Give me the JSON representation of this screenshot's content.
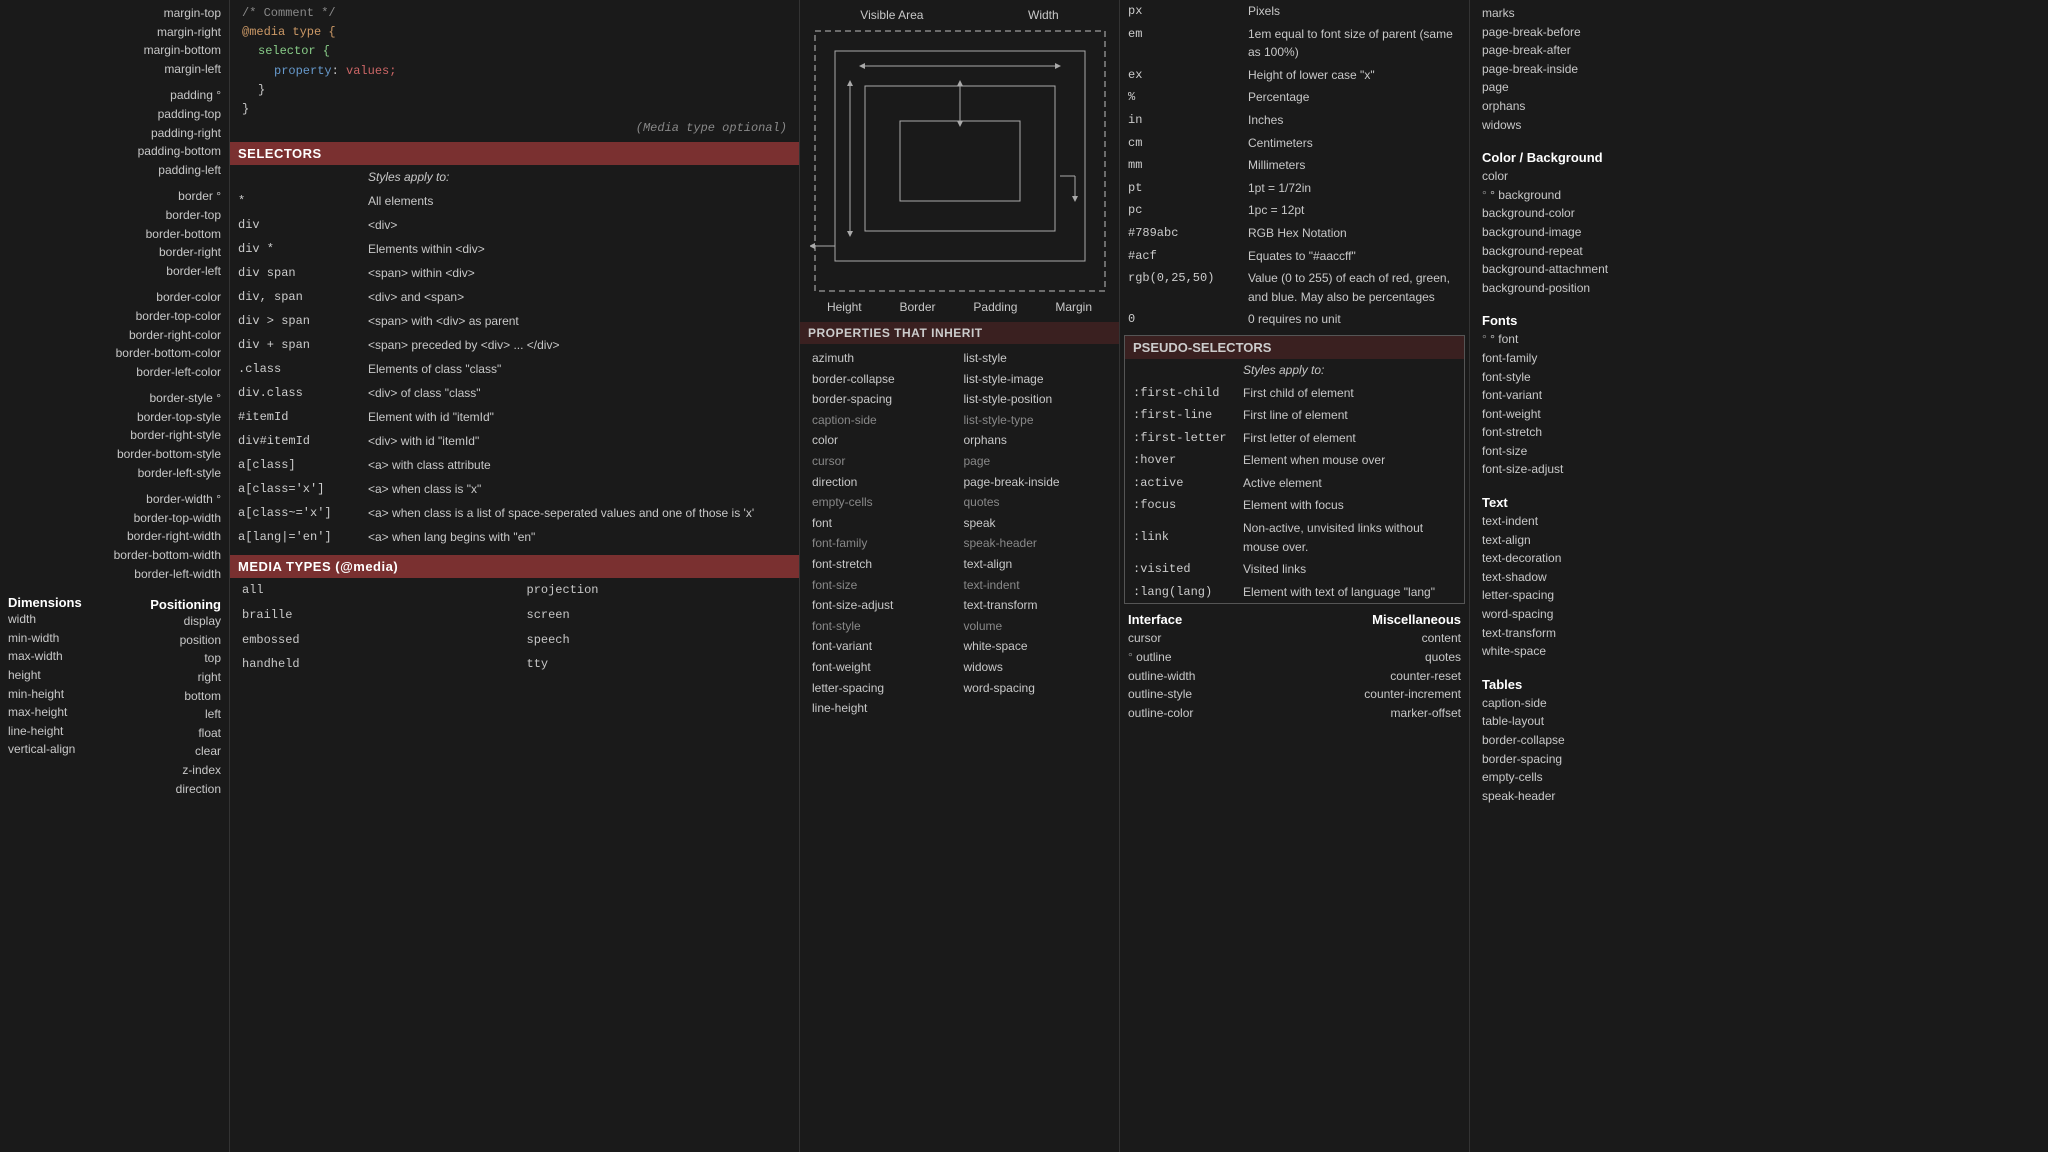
{
  "left": {
    "box_model_items": [
      {
        "label": "margin-top",
        "dot": false
      },
      {
        "label": "margin-right",
        "dot": false
      },
      {
        "label": "margin-bottom",
        "dot": false
      },
      {
        "label": "margin-left",
        "dot": false
      },
      {
        "label": "padding",
        "dot": true
      },
      {
        "label": "padding-top",
        "dot": false
      },
      {
        "label": "padding-right",
        "dot": false
      },
      {
        "label": "padding-bottom",
        "dot": false
      },
      {
        "label": "padding-left",
        "dot": false
      },
      {
        "label": "border",
        "dot": true
      },
      {
        "label": "border-top",
        "dot": false
      },
      {
        "label": "border-bottom",
        "dot": false
      },
      {
        "label": "border-right",
        "dot": false
      },
      {
        "label": "border-left",
        "dot": false
      },
      {
        "label": "border-color",
        "dot": false
      },
      {
        "label": "border-top-color",
        "dot": false
      },
      {
        "label": "border-right-color",
        "dot": false
      },
      {
        "label": "border-bottom-color",
        "dot": false
      },
      {
        "label": "border-left-color",
        "dot": false
      },
      {
        "label": "border-style",
        "dot": true
      },
      {
        "label": "border-top-style",
        "dot": false
      },
      {
        "label": "border-right-style",
        "dot": false
      },
      {
        "label": "border-bottom-style",
        "dot": false
      },
      {
        "label": "border-left-style",
        "dot": false
      },
      {
        "label": "border-width",
        "dot": true
      },
      {
        "label": "border-top-width",
        "dot": false
      },
      {
        "label": "border-right-width",
        "dot": false
      },
      {
        "label": "border-bottom-width",
        "dot": false
      },
      {
        "label": "border-left-width",
        "dot": false
      }
    ],
    "positioning_title": "Positioning",
    "positioning_items": [
      {
        "label": "display",
        "side": "right"
      },
      {
        "label": "position",
        "side": "right"
      },
      {
        "label": "top",
        "side": "right"
      },
      {
        "label": "right",
        "side": "right"
      },
      {
        "label": "bottom",
        "side": "right"
      },
      {
        "label": "left",
        "side": "right"
      },
      {
        "label": "float",
        "side": "right"
      },
      {
        "label": "clear",
        "side": "right"
      },
      {
        "label": "z-index",
        "side": "right"
      },
      {
        "label": "direction",
        "side": "right"
      }
    ],
    "dimensions_title": "Dimensions",
    "dimensions_items": [
      "width",
      "min-width",
      "max-width",
      "height",
      "min-height",
      "max-height",
      "line-height",
      "vertical-align"
    ]
  },
  "middle": {
    "code_lines": [
      {
        "text": "/* Comment */",
        "type": "comment"
      },
      {
        "text": "@media type {",
        "type": "at"
      },
      {
        "text": "    selector {",
        "type": "selector",
        "indent": 1
      },
      {
        "text": "        property: values;",
        "type": "property",
        "indent": 2
      },
      {
        "text": "    }",
        "type": "brace",
        "indent": 1
      },
      {
        "text": "}",
        "type": "brace"
      },
      {
        "text": "(Media type optional)",
        "type": "italic"
      }
    ],
    "selectors_title": "SELECTORS",
    "selectors_style_header": "Styles apply to:",
    "selectors_rows": [
      {
        "selector": "*",
        "description": "All elements"
      },
      {
        "selector": "div",
        "description": "<div>"
      },
      {
        "selector": "div *",
        "description": "Elements within <div>"
      },
      {
        "selector": "div span",
        "description": "<span> within <div>"
      },
      {
        "selector": "div, span",
        "description": "<div> and <span>"
      },
      {
        "selector": "div > span",
        "description": "<span> with <div> as parent"
      },
      {
        "selector": "div + span",
        "description": "<span> preceded by <div> ... </div>"
      },
      {
        "selector": ".class",
        "description": "Elements of class \"class\""
      },
      {
        "selector": "div.class",
        "description": "<div> of class \"class\""
      },
      {
        "selector": "#itemId",
        "description": "Element with id \"itemId\""
      },
      {
        "selector": "div#itemId",
        "description": "<div> with id \"itemId\""
      },
      {
        "selector": "a[class]",
        "description": "<a> with class attribute"
      },
      {
        "selector": "a[class='x']",
        "description": "<a> when class is \"x\""
      },
      {
        "selector": "a[class~='x']",
        "description": "<a> when class is a list of space-seperated values and one of those is 'x'"
      },
      {
        "selector": "a[lang|='en']",
        "description": "<a> when lang begins with \"en\""
      }
    ],
    "media_title": "MEDIA TYPES (@media)",
    "media_rows": [
      {
        "col1": "all",
        "col2": "projection"
      },
      {
        "col1": "braille",
        "col2": "screen"
      },
      {
        "col1": "embossed",
        "col2": "speech"
      },
      {
        "col1": "handheld",
        "col2": "tty"
      }
    ]
  },
  "center": {
    "visual_top_labels": [
      "Visible Area",
      "Width"
    ],
    "visual_bottom_labels": [
      "Height",
      "Border",
      "Padding",
      "Margin"
    ],
    "properties_title": "PROPERTIES THAT INHERIT",
    "properties": [
      {
        "label": "azimuth",
        "greyed": false
      },
      {
        "label": "list-style",
        "greyed": false
      },
      {
        "label": "border-collapse",
        "greyed": false
      },
      {
        "label": "list-style-image",
        "greyed": false
      },
      {
        "label": "border-spacing",
        "greyed": false
      },
      {
        "label": "list-style-position",
        "greyed": false
      },
      {
        "label": "caption-side",
        "greyed": true
      },
      {
        "label": "list-style-type",
        "greyed": true
      },
      {
        "label": "color",
        "greyed": false
      },
      {
        "label": "orphans",
        "greyed": false
      },
      {
        "label": "cursor",
        "greyed": true
      },
      {
        "label": "page",
        "greyed": true
      },
      {
        "label": "direction",
        "greyed": false
      },
      {
        "label": "page-break-inside",
        "greyed": false
      },
      {
        "label": "empty-cells",
        "greyed": true
      },
      {
        "label": "quotes",
        "greyed": true
      },
      {
        "label": "font",
        "greyed": false
      },
      {
        "label": "speak",
        "greyed": false
      },
      {
        "label": "font-family",
        "greyed": true
      },
      {
        "label": "speak-header",
        "greyed": true
      },
      {
        "label": "font-stretch",
        "greyed": false
      },
      {
        "label": "text-align",
        "greyed": false
      },
      {
        "label": "font-size",
        "greyed": true
      },
      {
        "label": "text-indent",
        "greyed": true
      },
      {
        "label": "font-size-adjust",
        "greyed": false
      },
      {
        "label": "text-transform",
        "greyed": false
      },
      {
        "label": "font-style",
        "greyed": true
      },
      {
        "label": "volume",
        "greyed": true
      },
      {
        "label": "font-variant",
        "greyed": false
      },
      {
        "label": "white-space",
        "greyed": false
      },
      {
        "label": "font-weight",
        "greyed": false
      },
      {
        "label": "widows",
        "greyed": false
      },
      {
        "label": "letter-spacing",
        "greyed": false
      },
      {
        "label": "word-spacing",
        "greyed": false
      },
      {
        "label": "line-height",
        "greyed": false
      }
    ]
  },
  "units": {
    "rows": [
      {
        "unit": "px",
        "description": "Pixels"
      },
      {
        "unit": "em",
        "description": "1em equal to font size of parent (same as 100%)"
      },
      {
        "unit": "ex",
        "description": "Height of lower case \"x\""
      },
      {
        "unit": "%",
        "description": "Percentage"
      },
      {
        "unit": "in",
        "description": "Inches"
      },
      {
        "unit": "cm",
        "description": "Centimeters"
      },
      {
        "unit": "mm",
        "description": "Millimeters"
      },
      {
        "unit": "pt",
        "description": "1pt = 1/72in"
      },
      {
        "unit": "pc",
        "description": "1pc = 12pt"
      },
      {
        "unit": "#789abc",
        "description": "RGB Hex Notation"
      },
      {
        "unit": "#acf",
        "description": "Equates to \"#aaccff\""
      },
      {
        "unit": "rgb(0,25,50)",
        "description": "Value (0 to 255) of each of red, green, and blue. May also be percentages"
      },
      {
        "unit": "0",
        "description": "0 requires no unit"
      }
    ],
    "pseudo_title": "PSEUDO-SELECTORS",
    "pseudo_style_header": "Styles apply to:",
    "pseudo_rows": [
      {
        "selector": ":first-child",
        "description": "First child of element"
      },
      {
        "selector": ":first-line",
        "description": "First line of element"
      },
      {
        "selector": ":first-letter",
        "description": "First letter of element"
      },
      {
        "selector": ":hover",
        "description": "Element when mouse over"
      },
      {
        "selector": ":active",
        "description": "Active element"
      },
      {
        "selector": ":focus",
        "description": "Element with focus"
      },
      {
        "selector": ":link",
        "description": "Non-active, unvisited links without mouse over."
      },
      {
        "selector": ":visited",
        "description": "Visited links"
      },
      {
        "selector": ":lang(lang)",
        "description": "Element with text of language \"lang\""
      }
    ],
    "interface_title": "Interface",
    "interface_items": [
      {
        "label": "cursor",
        "dot": false
      },
      {
        "label": "outline",
        "dot": true
      },
      {
        "label": "outline-width",
        "dot": false
      },
      {
        "label": "outline-style",
        "dot": false
      },
      {
        "label": "outline-color",
        "dot": false
      }
    ],
    "misc_title": "Miscellaneous",
    "misc_items": [
      {
        "label": "content",
        "dot": false
      },
      {
        "label": "quotes",
        "dot": false
      },
      {
        "label": "counter-reset",
        "dot": false
      },
      {
        "label": "counter-increment",
        "dot": false
      },
      {
        "label": "marker-offset",
        "dot": false
      }
    ]
  },
  "right": {
    "top_items": [
      "marks",
      "page-break-before",
      "page-break-after",
      "page-break-inside",
      "page",
      "orphans",
      "widows"
    ],
    "sections": [
      {
        "title": "Color / Background",
        "items": [
          {
            "label": "color",
            "dot": false
          },
          {
            "label": "background",
            "dot": true
          },
          {
            "label": "background-color",
            "dot": false
          },
          {
            "label": "background-image",
            "dot": false
          },
          {
            "label": "background-repeat",
            "dot": false
          },
          {
            "label": "background-attachment",
            "dot": false
          },
          {
            "label": "background-position",
            "dot": false
          }
        ]
      },
      {
        "title": "Fonts",
        "items": [
          {
            "label": "font",
            "dot": true
          },
          {
            "label": "font-family",
            "dot": false
          },
          {
            "label": "font-style",
            "dot": false
          },
          {
            "label": "font-variant",
            "dot": false
          },
          {
            "label": "font-weight",
            "dot": false
          },
          {
            "label": "font-stretch",
            "dot": false
          },
          {
            "label": "font-size",
            "dot": false
          },
          {
            "label": "font-size-adjust",
            "dot": false
          }
        ]
      },
      {
        "title": "Text",
        "items": [
          {
            "label": "text-indent",
            "dot": false
          },
          {
            "label": "text-align",
            "dot": false
          },
          {
            "label": "text-decoration",
            "dot": false
          },
          {
            "label": "text-shadow",
            "dot": false
          },
          {
            "label": "letter-spacing",
            "dot": false
          },
          {
            "label": "word-spacing",
            "dot": false
          },
          {
            "label": "text-transform",
            "dot": false
          },
          {
            "label": "white-space",
            "dot": false
          }
        ]
      },
      {
        "title": "Tables",
        "items": [
          {
            "label": "caption-side",
            "dot": false
          },
          {
            "label": "table-layout",
            "dot": false
          },
          {
            "label": "border-collapse",
            "dot": false
          },
          {
            "label": "border-spacing",
            "dot": false
          },
          {
            "label": "empty-cells",
            "dot": false
          },
          {
            "label": "speak-header",
            "dot": false
          }
        ]
      }
    ]
  }
}
